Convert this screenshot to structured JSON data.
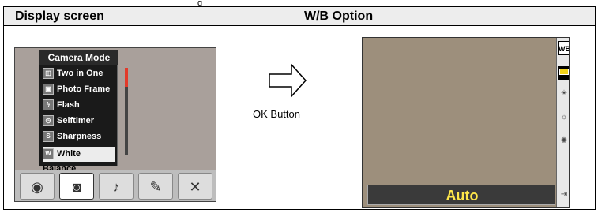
{
  "table": {
    "col1_header": "Display screen",
    "col2_header": "W/B Option",
    "top_crop_text": "g"
  },
  "left_screen": {
    "menu_title": "Camera Mode",
    "menu_items": [
      {
        "label": "Two in One",
        "selected": false
      },
      {
        "label": "Photo Frame",
        "selected": false
      },
      {
        "label": "Flash",
        "selected": false
      },
      {
        "label": "Selftimer",
        "selected": false
      },
      {
        "label": "Sharpness",
        "selected": false
      },
      {
        "label": "White Balance",
        "selected": true
      }
    ],
    "mode_icons": [
      "film-reel-icon",
      "camera-icon",
      "microphone-icon",
      "palette-icon",
      "tools-icon"
    ]
  },
  "middle": {
    "button_label": "OK Button"
  },
  "right_screen": {
    "wb_badge": "WB",
    "wb_options": [
      "auto-wb-icon",
      "daylight-icon",
      "fluorescent-icon",
      "tungsten-icon",
      "exit-icon"
    ],
    "current_option": "Auto"
  },
  "colors": {
    "option_text": "#ffe84a",
    "selection": "#ececec",
    "scroll_accent": "#e23a2a"
  }
}
